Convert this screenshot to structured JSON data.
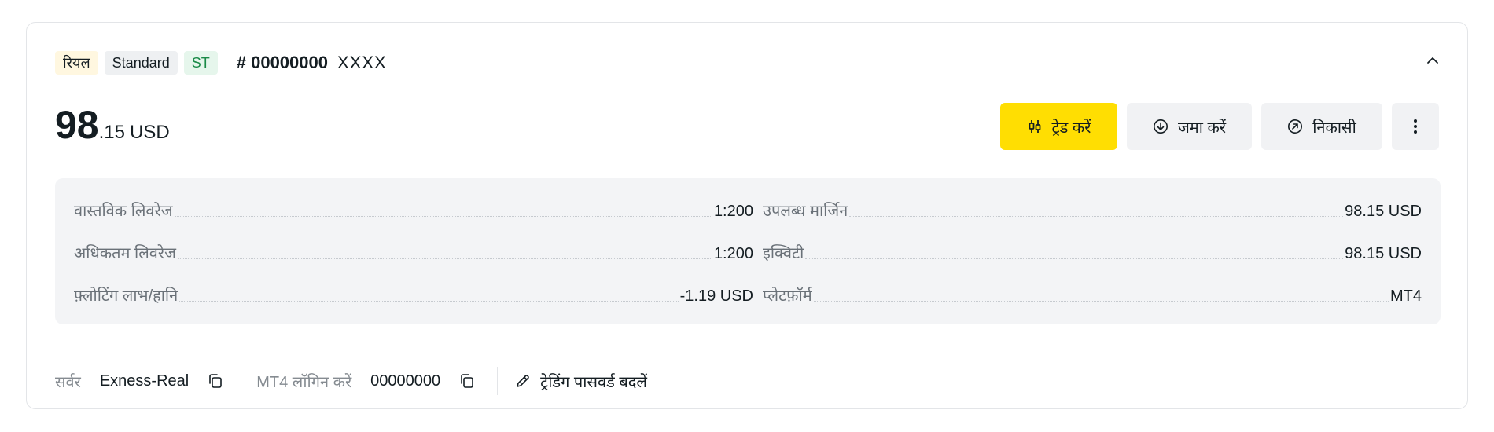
{
  "header": {
    "tags": {
      "real": "रियल",
      "standard": "Standard",
      "st": "ST"
    },
    "account_number": "# 00000000",
    "account_name": "XXXX"
  },
  "balance": {
    "integer": "98",
    "decimal": ".15",
    "currency": "USD"
  },
  "actions": {
    "trade": "ट्रेड करें",
    "deposit": "जमा करें",
    "withdraw": "निकासी"
  },
  "info": {
    "left": [
      {
        "label": "वास्तविक लिवरेज",
        "value": "1:200"
      },
      {
        "label": "अधिकतम लिवरेज",
        "value": "1:200"
      },
      {
        "label": "फ़्लोटिंग लाभ/हानि",
        "value": "-1.19 USD"
      }
    ],
    "right": [
      {
        "label": "उपलब्ध मार्जिन",
        "value": "98.15 USD"
      },
      {
        "label": "इक्विटी",
        "value": "98.15 USD"
      },
      {
        "label": "प्लेटफ़ॉर्म",
        "value": "MT4"
      }
    ]
  },
  "footer": {
    "server_label": "सर्वर",
    "server_value": "Exness-Real",
    "login_label": "MT4 लॉगिन करें",
    "login_value": "00000000",
    "change_password": "ट्रेडिंग पासवर्ड बदलें"
  },
  "colors": {
    "accent": "#ffde02",
    "panel": "#f3f4f6",
    "st_tag": "#1a8a47"
  },
  "icons": [
    "chevron-up-icon",
    "trade-icon",
    "deposit-icon",
    "withdraw-icon",
    "more-icon",
    "copy-icon",
    "pencil-icon"
  ]
}
